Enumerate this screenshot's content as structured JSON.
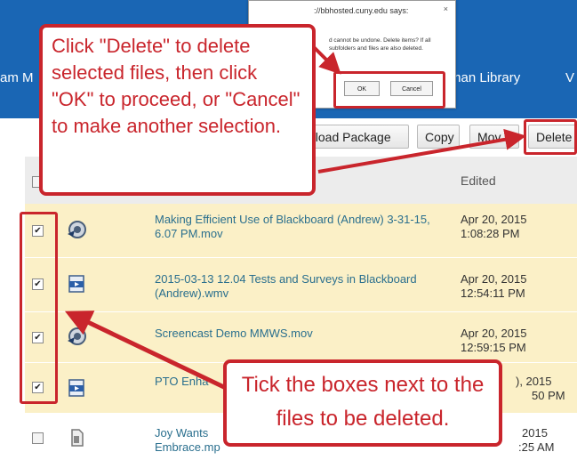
{
  "nav": {
    "item_left": "am M",
    "item_library": "man Library",
    "item_right": "V"
  },
  "dialog": {
    "title": "://bbhosted.cuny.edu says:",
    "close": "×",
    "message": "d cannot be undone. Delete items? If all subfolders and files are also deleted.",
    "ok_label": "OK",
    "cancel_label": "Cancel"
  },
  "toolbar": {
    "download_label": "nload Package",
    "copy_label": "Copy",
    "move_label": "Mov",
    "delete_label": "Delete"
  },
  "table": {
    "edited_header": "Edited",
    "rows": [
      {
        "name": "Making Efficient Use of Blackboard (Andrew) 3-31-15, 6.07 PM.mov",
        "date": "Apr 20, 2015",
        "time": "1:08:28 PM",
        "checked": true
      },
      {
        "name": "2015-03-13 12.04 Tests and Surveys in Blackboard (Andrew).wmv",
        "date": "Apr 20, 2015",
        "time": "12:54:11 PM",
        "checked": true
      },
      {
        "name": "Screencast Demo MMWS.mov",
        "date": "Apr 20, 2015",
        "time": "12:59:15 PM",
        "checked": true
      },
      {
        "name": "PTO Enha",
        "date": "), 2015",
        "time": "50 PM",
        "checked": true
      },
      {
        "name": "Joy Wants Embrace.mp",
        "date": "2015",
        "time": ":25 AM",
        "checked": false
      }
    ]
  },
  "callouts": {
    "top": "Click \"Delete\" to delete selected files, then click \"OK\" to proceed, or \"Cancel\" to make another selection.",
    "bottom": "Tick the boxes next to the files to be deleted."
  },
  "colors": {
    "nav_blue": "#1a66b4",
    "annotation_red": "#c9252c",
    "row_highlight": "#fbf0c7",
    "link_teal": "#2a6f8e"
  }
}
